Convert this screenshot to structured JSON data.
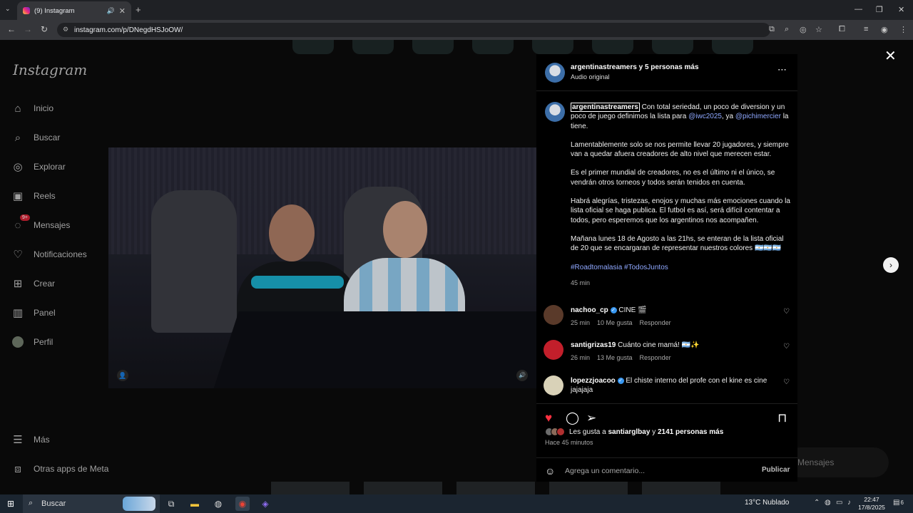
{
  "browser": {
    "tab_title": "(9) Instagram",
    "new_tab_label": "+",
    "url": "instagram.com/p/DNegdHSJoOW/"
  },
  "sidebar": {
    "logo": "Instagram",
    "items": [
      {
        "label": "Inicio",
        "icon": "home-icon"
      },
      {
        "label": "Buscar",
        "icon": "search-icon"
      },
      {
        "label": "Explorar",
        "icon": "compass-icon"
      },
      {
        "label": "Reels",
        "icon": "reels-icon"
      },
      {
        "label": "Mensajes",
        "icon": "messenger-icon",
        "badge": "9+"
      },
      {
        "label": "Notificaciones",
        "icon": "heart-icon"
      },
      {
        "label": "Crear",
        "icon": "plus-square-icon"
      },
      {
        "label": "Panel",
        "icon": "chart-icon"
      },
      {
        "label": "Perfil",
        "icon": "avatar-icon"
      }
    ],
    "bottom_items": [
      {
        "label": "Más",
        "icon": "menu-icon"
      },
      {
        "label": "Otras apps de Meta",
        "icon": "meta-icon"
      }
    ]
  },
  "messages_pill": "Mensajes",
  "post": {
    "author": "argentinastreamers",
    "coauthors": "y 5 personas más",
    "audio": "Audio original",
    "caption_author": "argentinastreamers",
    "caption_p1_a": "Con total seriedad, un poco de diversion y un poco de juego definimos la lista para",
    "mention1": "@iwc2025",
    "caption_p1_b": ", ya",
    "mention2": "@pichimercier",
    "caption_p1_c": "la tiene.",
    "caption_p2": "Lamentablemente solo se nos permite llevar 20 jugadores, y siempre van a quedar afuera creadores de alto nivel que merecen estar.",
    "caption_p3": "Es el primer mundial de creadores, no es el último ni el único, se vendrán otros torneos y todos serán tenidos en cuenta.",
    "caption_p4": "Habrá alegrías, tristezas, enojos y muchas más emociones cuando la lista oficial se haga publica. El futbol es así, será difícil contentar a todos, pero esperemos que los argentinos nos acompañen.",
    "caption_p5": "Mañana lunes 18 de Agosto a las 21hs, se enteran de la lista oficial de 20 que se encargaran de representar nuestros colores 🇦🇷🇦🇷🇦🇷",
    "hashtags": "#Roadtomalasia #TodosJuntos",
    "caption_age": "45 min",
    "likes_prefix": "Les gusta a",
    "likes_user": "santiarglbay",
    "likes_middle": "y",
    "likes_count": "2141 personas más",
    "posted_ago": "Hace 45 minutos"
  },
  "comments": [
    {
      "user": "nachoo_cp",
      "verified": true,
      "text": "CINE 🎬",
      "time": "25 min",
      "likes": "10 Me gusta",
      "reply": "Responder",
      "avatar_color": "#5a3a2a"
    },
    {
      "user": "santigrizas19",
      "verified": false,
      "text": "Cuánto cine mamá! 🇦🇷✨",
      "time": "26 min",
      "likes": "13 Me gusta",
      "reply": "Responder",
      "avatar_color": "#c21f2b"
    },
    {
      "user": "lopezzjoacoo",
      "verified": true,
      "text": "El chiste interno del profe con el kine es cine jajajaja",
      "time": "",
      "likes": "",
      "reply": "",
      "avatar_color": "#d9d2b8"
    }
  ],
  "comment_box": {
    "placeholder": "Agrega un comentario...",
    "publish_label": "Publicar"
  },
  "taskbar": {
    "search_label": "Buscar",
    "weather": "13°C  Nublado",
    "time": "22:47",
    "date": "17/8/2025",
    "notification_count": "6"
  }
}
